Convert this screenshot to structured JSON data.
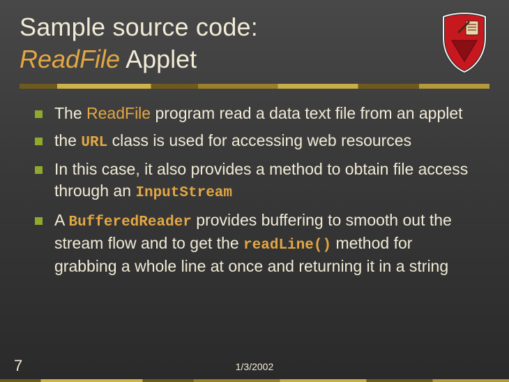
{
  "title": {
    "line1": "Sample source code:",
    "emphasis": "ReadFile",
    "line2_rest": " Applet"
  },
  "bullets": [
    {
      "segments": [
        {
          "t": "The ",
          "cls": ""
        },
        {
          "t": "ReadFile",
          "cls": "hl"
        },
        {
          "t": " program read a data text file from an applet",
          "cls": ""
        }
      ]
    },
    {
      "segments": [
        {
          "t": "the ",
          "cls": ""
        },
        {
          "t": "URL",
          "cls": "code"
        },
        {
          "t": " class is used for accessing web resources",
          "cls": ""
        }
      ]
    },
    {
      "segments": [
        {
          "t": "In this case, it also provides a method to obtain file access through an ",
          "cls": ""
        },
        {
          "t": "InputStream",
          "cls": "code"
        }
      ]
    },
    {
      "segments": [
        {
          "t": "A ",
          "cls": ""
        },
        {
          "t": "BufferedReader",
          "cls": "code"
        },
        {
          "t": " provides buffering to smooth out the stream flow and to get the ",
          "cls": ""
        },
        {
          "t": "readLine()",
          "cls": "code"
        },
        {
          "t": " method for grabbing a whole line at once and returning it in a string",
          "cls": ""
        }
      ]
    }
  ],
  "footer_date": "1/3/2002",
  "page_number": "7",
  "watermark": ""
}
